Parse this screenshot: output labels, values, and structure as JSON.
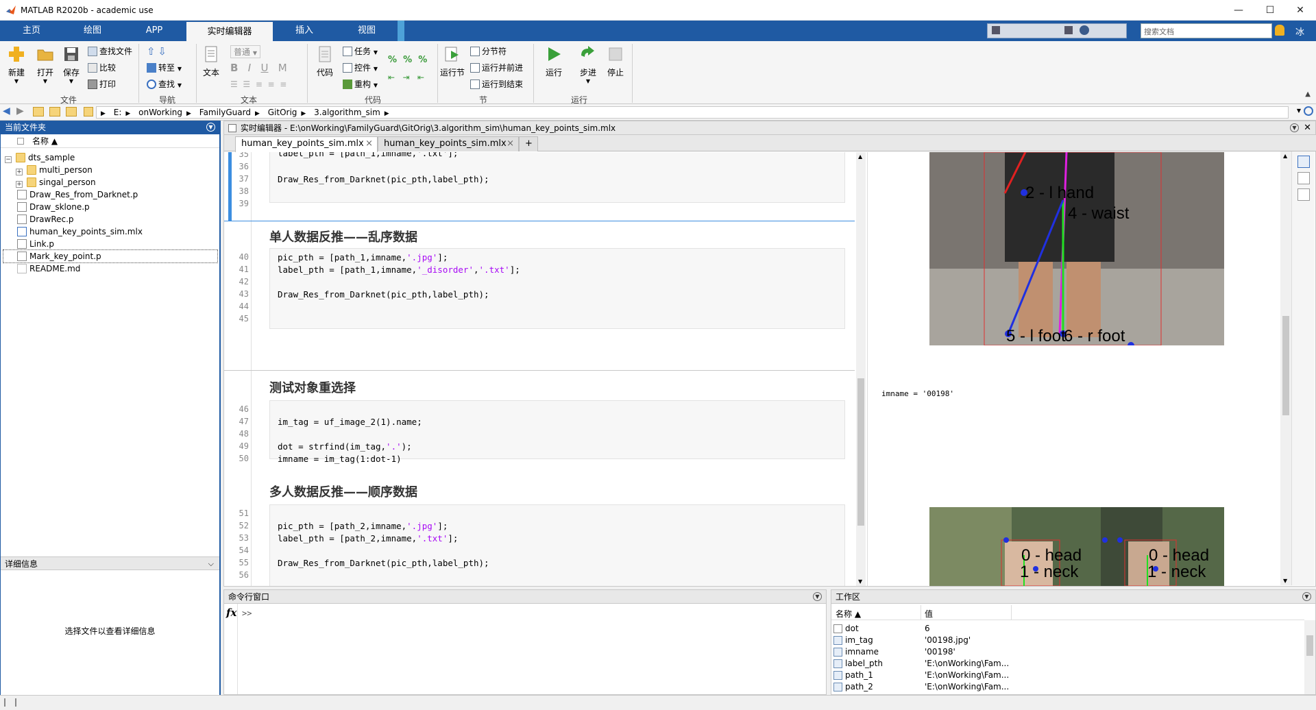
{
  "window": {
    "title": "MATLAB R2020b - academic use"
  },
  "tabs": [
    {
      "label": "主页"
    },
    {
      "label": "绘图"
    },
    {
      "label": "APP"
    },
    {
      "label": "实时编辑器"
    },
    {
      "label": "插入"
    },
    {
      "label": "视图"
    }
  ],
  "search": {
    "placeholder": "搜索文档"
  },
  "user": {
    "name": "冰"
  },
  "ribbon": {
    "file": {
      "new": "新建",
      "open": "打开",
      "save": "保存",
      "find_files": "查找文件",
      "compare": "比较",
      "print": "打印",
      "section": "文件"
    },
    "nav": {
      "goto": "转至",
      "find": "查找",
      "section": "导航"
    },
    "text": {
      "text": "文本",
      "style": "普通",
      "bold": "B",
      "italic": "I",
      "underline": "U",
      "mono": "M",
      "section": "文本"
    },
    "code": {
      "code": "代码",
      "task": "任务",
      "control": "控件",
      "refactor": "重构",
      "section": "代码"
    },
    "sec": {
      "run_section": "运行节",
      "section_break": "分节符",
      "run_advance": "运行并前进",
      "run_to_end": "运行到结束",
      "section": "节"
    },
    "run": {
      "run": "运行",
      "step": "步进",
      "stop": "停止",
      "section": "运行"
    }
  },
  "address": {
    "crumbs": [
      "E:",
      "onWorking",
      "FamilyGuard",
      "GitOrig",
      "3.algorithm_sim"
    ]
  },
  "current_folder": {
    "header": "当前文件夹",
    "col_name": "名称 ▲",
    "items": [
      {
        "label": "dts_sample",
        "type": "folder"
      },
      {
        "label": "multi_person",
        "type": "folder"
      },
      {
        "label": "singal_person",
        "type": "folder"
      },
      {
        "label": "Draw_Res_from_Darknet.p",
        "type": "p"
      },
      {
        "label": "Draw_sklone.p",
        "type": "p"
      },
      {
        "label": "DrawRec.p",
        "type": "p"
      },
      {
        "label": "human_key_points_sim.mlx",
        "type": "mlx"
      },
      {
        "label": "Link.p",
        "type": "p"
      },
      {
        "label": "Mark_key_point.p",
        "type": "p"
      },
      {
        "label": "README.md",
        "type": "md"
      }
    ]
  },
  "details": {
    "header": "详细信息",
    "hint": "选择文件以查看详细信息"
  },
  "editor": {
    "header": "实时编辑器 - E:\\onWorking\\FamilyGuard\\GitOrig\\3.algorithm_sim\\human_key_points_sim.mlx",
    "tabs": [
      "human_key_points_sim.mlx",
      "human_key_points_sim.mlx"
    ],
    "add_tab": "+",
    "lines_top": [
      "35",
      "36",
      "37",
      "38",
      "39"
    ],
    "code_top": {
      "l35": "label_pth = [path_1,imname,'.txt'];",
      "l37": "Draw_Res_from_Darknet(pic_pth,label_pth);"
    },
    "heading1": "单人数据反推——乱序数据",
    "lines_1": [
      "40",
      "41",
      "42",
      "43",
      "44",
      "45"
    ],
    "code_1": {
      "l40a": "pic_pth = [path_1,imname,",
      "l40s": "'.jpg'",
      "l40b": "];",
      "l41a": "label_pth = [path_1,imname,",
      "l41s1": "'_disorder'",
      "l41c": ",",
      "l41s2": "'.txt'",
      "l41b": "];",
      "l43": "Draw_Res_from_Darknet(pic_pth,label_pth);"
    },
    "heading2": "测试对象重选择",
    "lines_2": [
      "46",
      "47",
      "48",
      "49",
      "50"
    ],
    "code_2": {
      "l47": "im_tag = uf_image_2(1).name;",
      "l49a": "dot = strfind(im_tag,",
      "l49s": "'.'",
      "l49b": ");",
      "l50": "imname = im_tag(1:dot-1)"
    },
    "heading3": "多人数据反推——顺序数据",
    "lines_3": [
      "51",
      "52",
      "53",
      "54",
      "55",
      "56"
    ],
    "code_3": {
      "l52a": "pic_pth = [path_2,imname,",
      "l52s": "'.jpg'",
      "l52b": "];",
      "l53a": "label_pth = [path_2,imname,",
      "l53s": "'.txt'",
      "l53b": "];",
      "l55": "Draw_Res_from_Darknet(pic_pth,label_pth);"
    },
    "output": {
      "imname": "imname = '00198'",
      "labels1": [
        "2 - l hand",
        "4 - waist",
        "5 - l foot",
        "6 - r foot"
      ],
      "labels2": [
        "0 - head",
        "1 - neck",
        "0 - head",
        "1 - neck"
      ]
    }
  },
  "command_window": {
    "header": "命令行窗口",
    "fx": "fx",
    "prompt": ">>"
  },
  "workspace": {
    "header": "工作区",
    "col_name": "名称 ▲",
    "col_value": "值",
    "rows": [
      {
        "name": "dot",
        "value": "6"
      },
      {
        "name": "im_tag",
        "value": "'00198.jpg'"
      },
      {
        "name": "imname",
        "value": "'00198'"
      },
      {
        "name": "label_pth",
        "value": "'E:\\onWorking\\Fam..."
      },
      {
        "name": "path_1",
        "value": "'E:\\onWorking\\Fam..."
      },
      {
        "name": "path_2",
        "value": "'E:\\onWorking\\Fam..."
      }
    ]
  }
}
